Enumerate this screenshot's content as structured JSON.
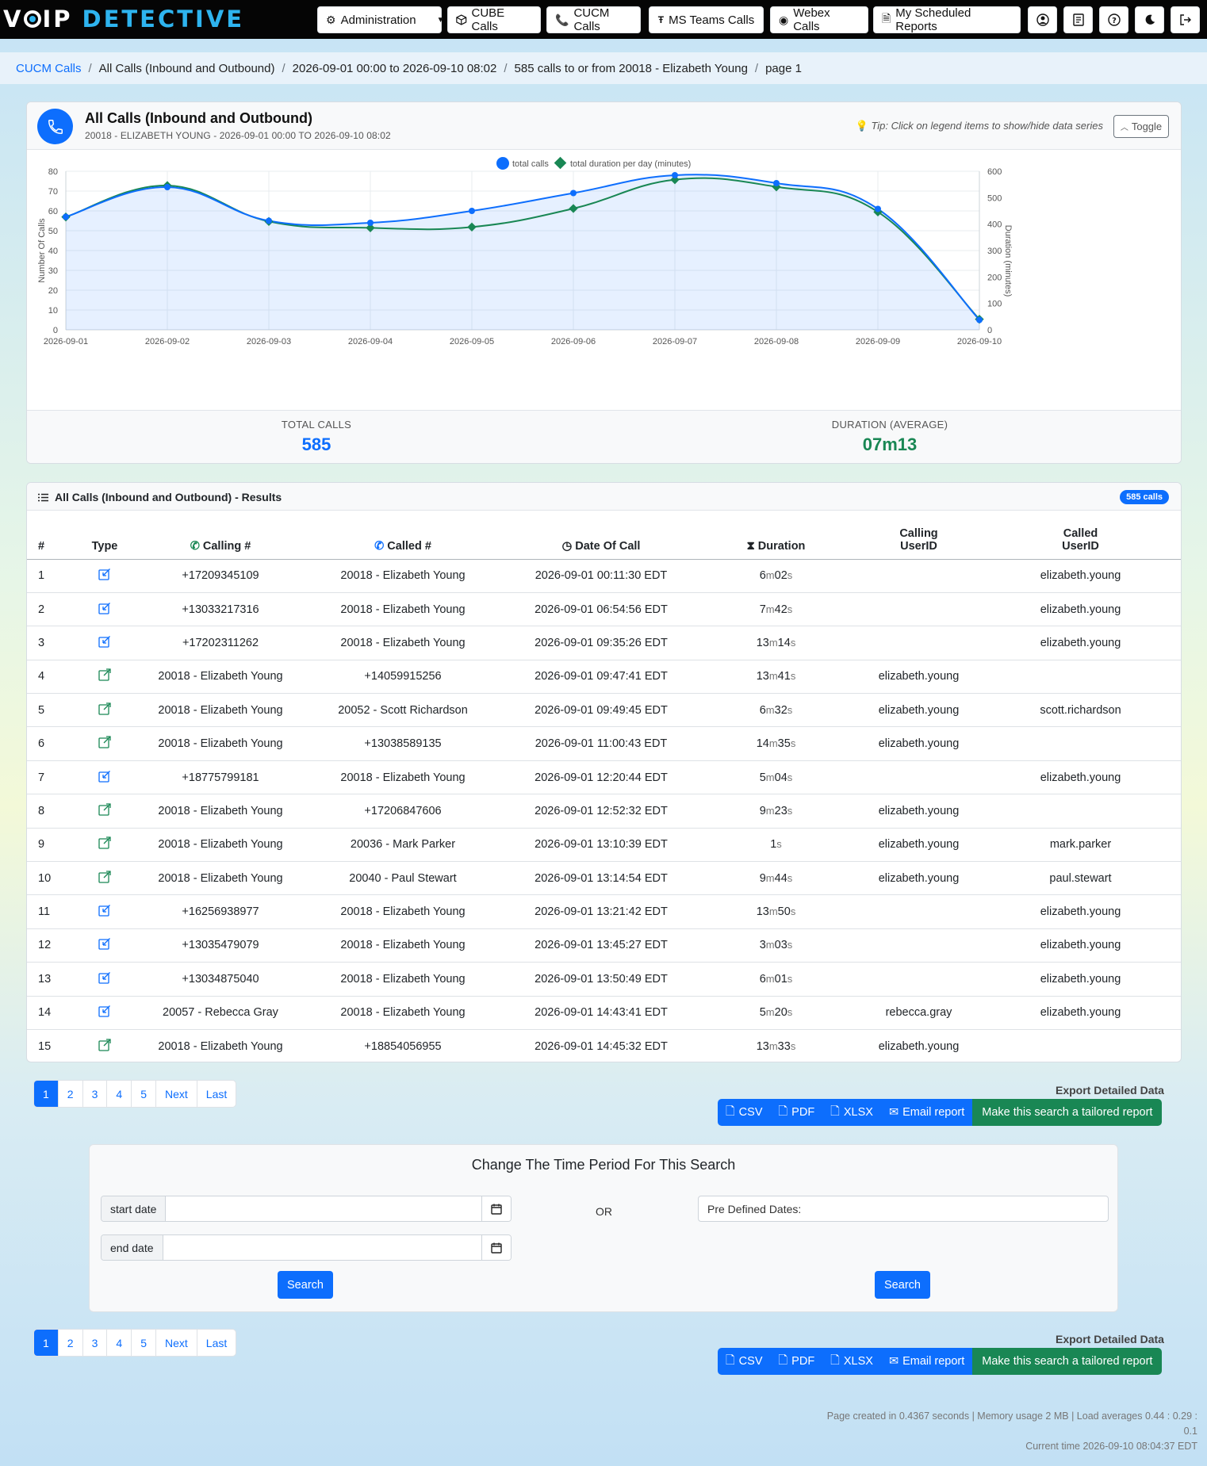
{
  "brand": {
    "part1": "V",
    "part2": "IP",
    "part3": "DETECTIVE"
  },
  "nav": {
    "administration": "Administration",
    "cube": "CUBE Calls",
    "cucm": "CUCM Calls",
    "msteams": "MS Teams Calls",
    "webex": "Webex Calls",
    "scheduled": "My Scheduled Reports"
  },
  "breadcrumb": [
    "CUCM Calls",
    "All Calls (Inbound and Outbound)",
    "2026-09-01 00:00 to 2026-09-10 08:02",
    "585 calls to or from 20018 - Elizabeth Young",
    "page 1"
  ],
  "chart_card": {
    "title": "All Calls (Inbound and Outbound)",
    "subtitle": "20018 - ELIZABETH YOUNG - 2026-09-01 00:00 TO 2026-09-10 08:02",
    "tip": "Tip: Click on legend items to show/hide data series",
    "toggle": "Toggle"
  },
  "chart_data": {
    "type": "line",
    "x": [
      "2026-09-01",
      "2026-09-02",
      "2026-09-03",
      "2026-09-04",
      "2026-09-05",
      "2026-09-06",
      "2026-09-07",
      "2026-09-08",
      "2026-09-09",
      "2026-09-10"
    ],
    "series": [
      {
        "name": "total calls",
        "axis": "left",
        "color": "#0d6efd",
        "values": [
          57,
          72,
          55,
          54,
          60,
          69,
          78,
          74,
          61,
          5
        ]
      },
      {
        "name": "total duration per day (minutes)",
        "axis": "right",
        "color": "#198754",
        "values": [
          427,
          546,
          410,
          386,
          389,
          459,
          568,
          541,
          446,
          40
        ]
      }
    ],
    "ylabel": "Number Of Calls",
    "y2label": "Duration (minutes)",
    "ylim": [
      0,
      80
    ],
    "y2lim": [
      0,
      600
    ],
    "yticks": [
      0,
      10,
      20,
      30,
      40,
      50,
      60,
      70,
      80
    ],
    "y2ticks": [
      0,
      100,
      200,
      300,
      400,
      500,
      600
    ],
    "grid": true,
    "legend": "top-center"
  },
  "stats": {
    "total_label": "TOTAL CALLS",
    "total_value": "585",
    "duration_label": "DURATION (AVERAGE)",
    "duration_value": "07m13",
    "total_color": "#0d6efd",
    "duration_color": "#198754"
  },
  "results": {
    "title": "All Calls (Inbound and Outbound) - Results",
    "badge": "585 calls",
    "columns": {
      "num": "#",
      "type": "Type",
      "calling": "Calling #",
      "called": "Called #",
      "date": "Date Of Call",
      "duration": "Duration",
      "calling_user_l1": "Calling",
      "calling_user_l2": "UserID",
      "called_user_l1": "Called",
      "called_user_l2": "UserID"
    },
    "rows": [
      {
        "n": "1",
        "dir": "in",
        "calling": "+17209345109",
        "called": "20018 - Elizabeth Young",
        "date": "2026-09-01 00:11:30 EDT",
        "dm": "6",
        "ds": "02",
        "cu": "",
        "du": "elizabeth.young"
      },
      {
        "n": "2",
        "dir": "in",
        "calling": "+13033217316",
        "called": "20018 - Elizabeth Young",
        "date": "2026-09-01 06:54:56 EDT",
        "dm": "7",
        "ds": "42",
        "cu": "",
        "du": "elizabeth.young"
      },
      {
        "n": "3",
        "dir": "in",
        "calling": "+17202311262",
        "called": "20018 - Elizabeth Young",
        "date": "2026-09-01 09:35:26 EDT",
        "dm": "13",
        "ds": "14",
        "cu": "",
        "du": "elizabeth.young"
      },
      {
        "n": "4",
        "dir": "out",
        "calling": "20018 - Elizabeth Young",
        "called": "+14059915256",
        "date": "2026-09-01 09:47:41 EDT",
        "dm": "13",
        "ds": "41",
        "cu": "elizabeth.young",
        "du": ""
      },
      {
        "n": "5",
        "dir": "out",
        "calling": "20018 - Elizabeth Young",
        "called": "20052 - Scott Richardson",
        "date": "2026-09-01 09:49:45 EDT",
        "dm": "6",
        "ds": "32",
        "cu": "elizabeth.young",
        "du": "scott.richardson"
      },
      {
        "n": "6",
        "dir": "out",
        "calling": "20018 - Elizabeth Young",
        "called": "+13038589135",
        "date": "2026-09-01 11:00:43 EDT",
        "dm": "14",
        "ds": "35",
        "cu": "elizabeth.young",
        "du": ""
      },
      {
        "n": "7",
        "dir": "in",
        "calling": "+18775799181",
        "called": "20018 - Elizabeth Young",
        "date": "2026-09-01 12:20:44 EDT",
        "dm": "5",
        "ds": "04",
        "cu": "",
        "du": "elizabeth.young"
      },
      {
        "n": "8",
        "dir": "out",
        "calling": "20018 - Elizabeth Young",
        "called": "+17206847606",
        "date": "2026-09-01 12:52:32 EDT",
        "dm": "9",
        "ds": "23",
        "cu": "elizabeth.young",
        "du": ""
      },
      {
        "n": "9",
        "dir": "out",
        "calling": "20018 - Elizabeth Young",
        "called": "20036 - Mark Parker",
        "date": "2026-09-01 13:10:39 EDT",
        "dm": "",
        "ds": "1",
        "cu": "elizabeth.young",
        "du": "mark.parker"
      },
      {
        "n": "10",
        "dir": "out",
        "calling": "20018 - Elizabeth Young",
        "called": "20040 - Paul Stewart",
        "date": "2026-09-01 13:14:54 EDT",
        "dm": "9",
        "ds": "44",
        "cu": "elizabeth.young",
        "du": "paul.stewart"
      },
      {
        "n": "11",
        "dir": "in",
        "calling": "+16256938977",
        "called": "20018 - Elizabeth Young",
        "date": "2026-09-01 13:21:42 EDT",
        "dm": "13",
        "ds": "50",
        "cu": "",
        "du": "elizabeth.young"
      },
      {
        "n": "12",
        "dir": "in",
        "calling": "+13035479079",
        "called": "20018 - Elizabeth Young",
        "date": "2026-09-01 13:45:27 EDT",
        "dm": "3",
        "ds": "03",
        "cu": "",
        "du": "elizabeth.young"
      },
      {
        "n": "13",
        "dir": "in",
        "calling": "+13034875040",
        "called": "20018 - Elizabeth Young",
        "date": "2026-09-01 13:50:49 EDT",
        "dm": "6",
        "ds": "01",
        "cu": "",
        "du": "elizabeth.young"
      },
      {
        "n": "14",
        "dir": "in",
        "calling": "20057 - Rebecca Gray",
        "called": "20018 - Elizabeth Young",
        "date": "2026-09-01 14:43:41 EDT",
        "dm": "5",
        "ds": "20",
        "cu": "rebecca.gray",
        "du": "elizabeth.young"
      },
      {
        "n": "15",
        "dir": "out",
        "calling": "20018 - Elizabeth Young",
        "called": "+18854056955",
        "date": "2026-09-01 14:45:32 EDT",
        "dm": "13",
        "ds": "33",
        "cu": "elizabeth.young",
        "du": ""
      }
    ]
  },
  "pagination": {
    "pages": [
      "1",
      "2",
      "3",
      "4",
      "5"
    ],
    "next": "Next",
    "last": "Last",
    "active": "1"
  },
  "export": {
    "title": "Export Detailed Data",
    "csv": "CSV",
    "pdf": "PDF",
    "xlsx": "XLSX",
    "email": "Email report",
    "tailored": "Make this search a tailored report"
  },
  "time_period": {
    "title": "Change The Time Period For This Search",
    "start_label": "start date",
    "end_label": "end date",
    "or": "OR",
    "predefined": "Pre Defined Dates:",
    "search": "Search"
  },
  "footer": {
    "line1": "Page created in 0.4367 seconds | Memory usage 2 MB | Load averages 0.44 : 0.29 : 0.1",
    "line2": "Current time 2026-09-10 08:04:37 EDT"
  }
}
